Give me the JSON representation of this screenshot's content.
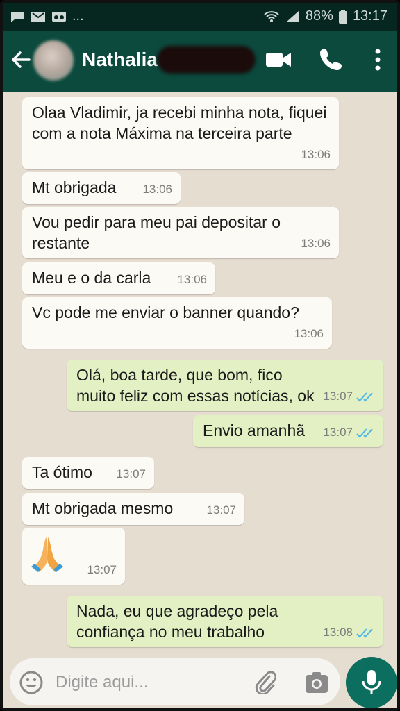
{
  "status_bar": {
    "battery_pct": "88%",
    "time": "13:17",
    "notif_more": "..."
  },
  "header": {
    "contact_name": "Nathalia"
  },
  "messages": [
    {
      "dir": "in",
      "text": "Olaa Vladimir, ja recebi minha nota, fiquei com a nota Máxima na terceira parte",
      "time": "13:06"
    },
    {
      "dir": "in",
      "text": "Mt obrigada",
      "time": "13:06"
    },
    {
      "dir": "in",
      "text": "Vou pedir para meu pai depositar o restante",
      "time": "13:06"
    },
    {
      "dir": "in",
      "text": "Meu e o da carla",
      "time": "13:06"
    },
    {
      "dir": "in",
      "text": "Vc pode me enviar o banner quando?",
      "time": "13:06"
    },
    {
      "dir": "out",
      "text": "Olá, boa tarde, que bom, fico muito feliz com essas notícias, ok",
      "time": "13:07",
      "status": "read"
    },
    {
      "dir": "out",
      "text": "Envio amanhã",
      "time": "13:07",
      "status": "read"
    },
    {
      "dir": "in",
      "text": "Ta ótimo",
      "time": "13:07"
    },
    {
      "dir": "in",
      "text": "Mt obrigada mesmo",
      "time": "13:07"
    },
    {
      "dir": "in",
      "text": "",
      "emoji": "folded-hands-icon",
      "time": "13:07"
    },
    {
      "dir": "out",
      "text": "Nada, eu que agradeço pela confiança no meu trabalho",
      "time": "13:08",
      "status": "read"
    }
  ],
  "input": {
    "placeholder": "Digite aqui..."
  },
  "colors": {
    "header": "#0b4a3d",
    "incoming": "#fbfaf4",
    "outgoing": "#e3f0c4",
    "read_ticks": "#4fb6e8",
    "mic_button": "#0c6e5f"
  }
}
